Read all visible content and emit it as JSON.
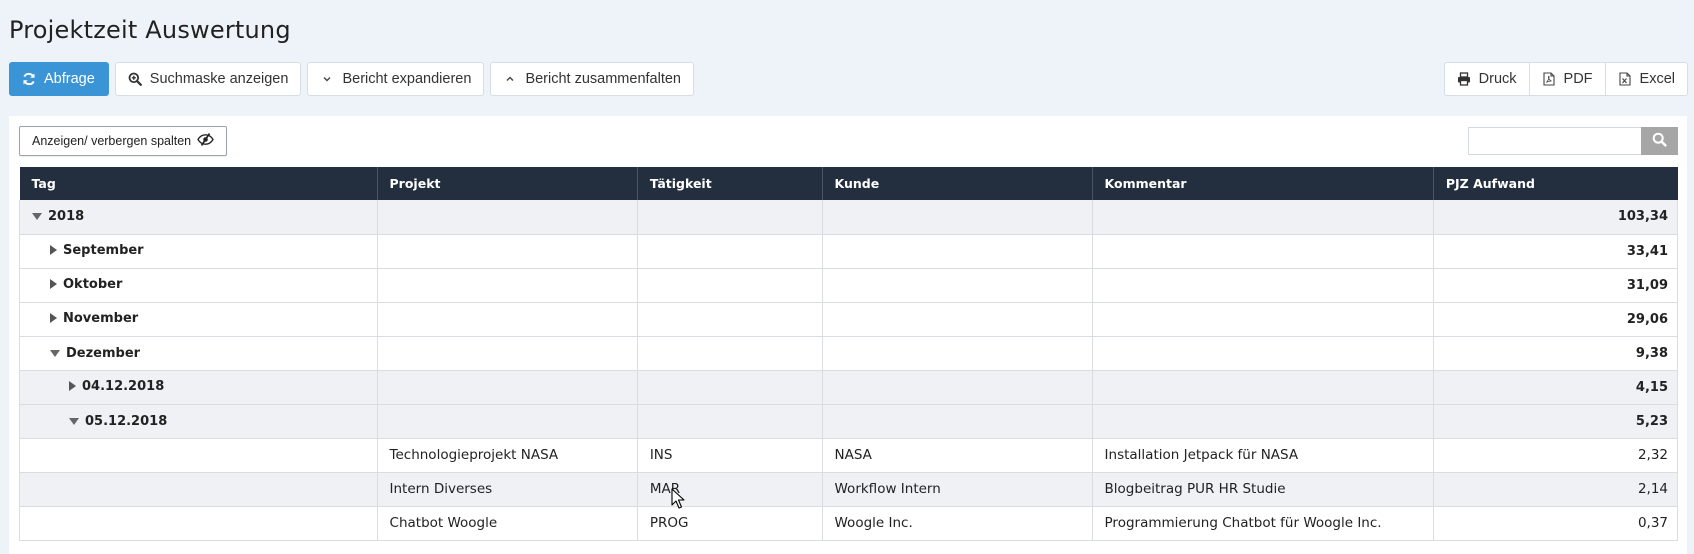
{
  "page": {
    "title": "Projektzeit Auswertung"
  },
  "toolbar": {
    "query_label": "Abfrage",
    "search_mask_label": "Suchmaske anzeigen",
    "expand_label": "Bericht expandieren",
    "collapse_label": "Bericht zusammenfalten",
    "print_label": "Druck",
    "pdf_label": "PDF",
    "excel_label": "Excel"
  },
  "colors": {
    "primary": "#3a94d6",
    "header_bg": "#232f3e",
    "row_shade": "#eff1f4"
  },
  "table": {
    "columns_toggle_label": "Anzeigen/ verbergen spalten",
    "search": {
      "value": "",
      "placeholder": ""
    },
    "headers": [
      "Tag",
      "Projekt",
      "Tätigkeit",
      "Kunde",
      "Kommentar",
      "PJZ Aufwand"
    ],
    "groups": [
      {
        "label": "2018",
        "total": "103,34"
      },
      {
        "label": "September",
        "total": "33,41"
      },
      {
        "label": "Oktober",
        "total": "31,09"
      },
      {
        "label": "November",
        "total": "29,06"
      },
      {
        "label": "Dezember",
        "total": "9,38"
      },
      {
        "label": "04.12.2018",
        "total": "4,15"
      },
      {
        "label": "05.12.2018",
        "total": "5,23"
      }
    ],
    "details": [
      {
        "projekt": "Technologieprojekt NASA",
        "taetigkeit": "INS",
        "kunde": "NASA",
        "kommentar": "Installation Jetpack für NASA",
        "aufwand": "2,32"
      },
      {
        "projekt": "Intern Diverses",
        "taetigkeit": "MAR",
        "kunde": "Workflow Intern",
        "kommentar": "Blogbeitrag PUR HR Studie",
        "aufwand": "2,14"
      },
      {
        "projekt": "Chatbot Woogle",
        "taetigkeit": "PROG",
        "kunde": "Woogle Inc.",
        "kommentar": "Programmierung Chatbot für Woogle Inc.",
        "aufwand": "0,37"
      }
    ]
  }
}
